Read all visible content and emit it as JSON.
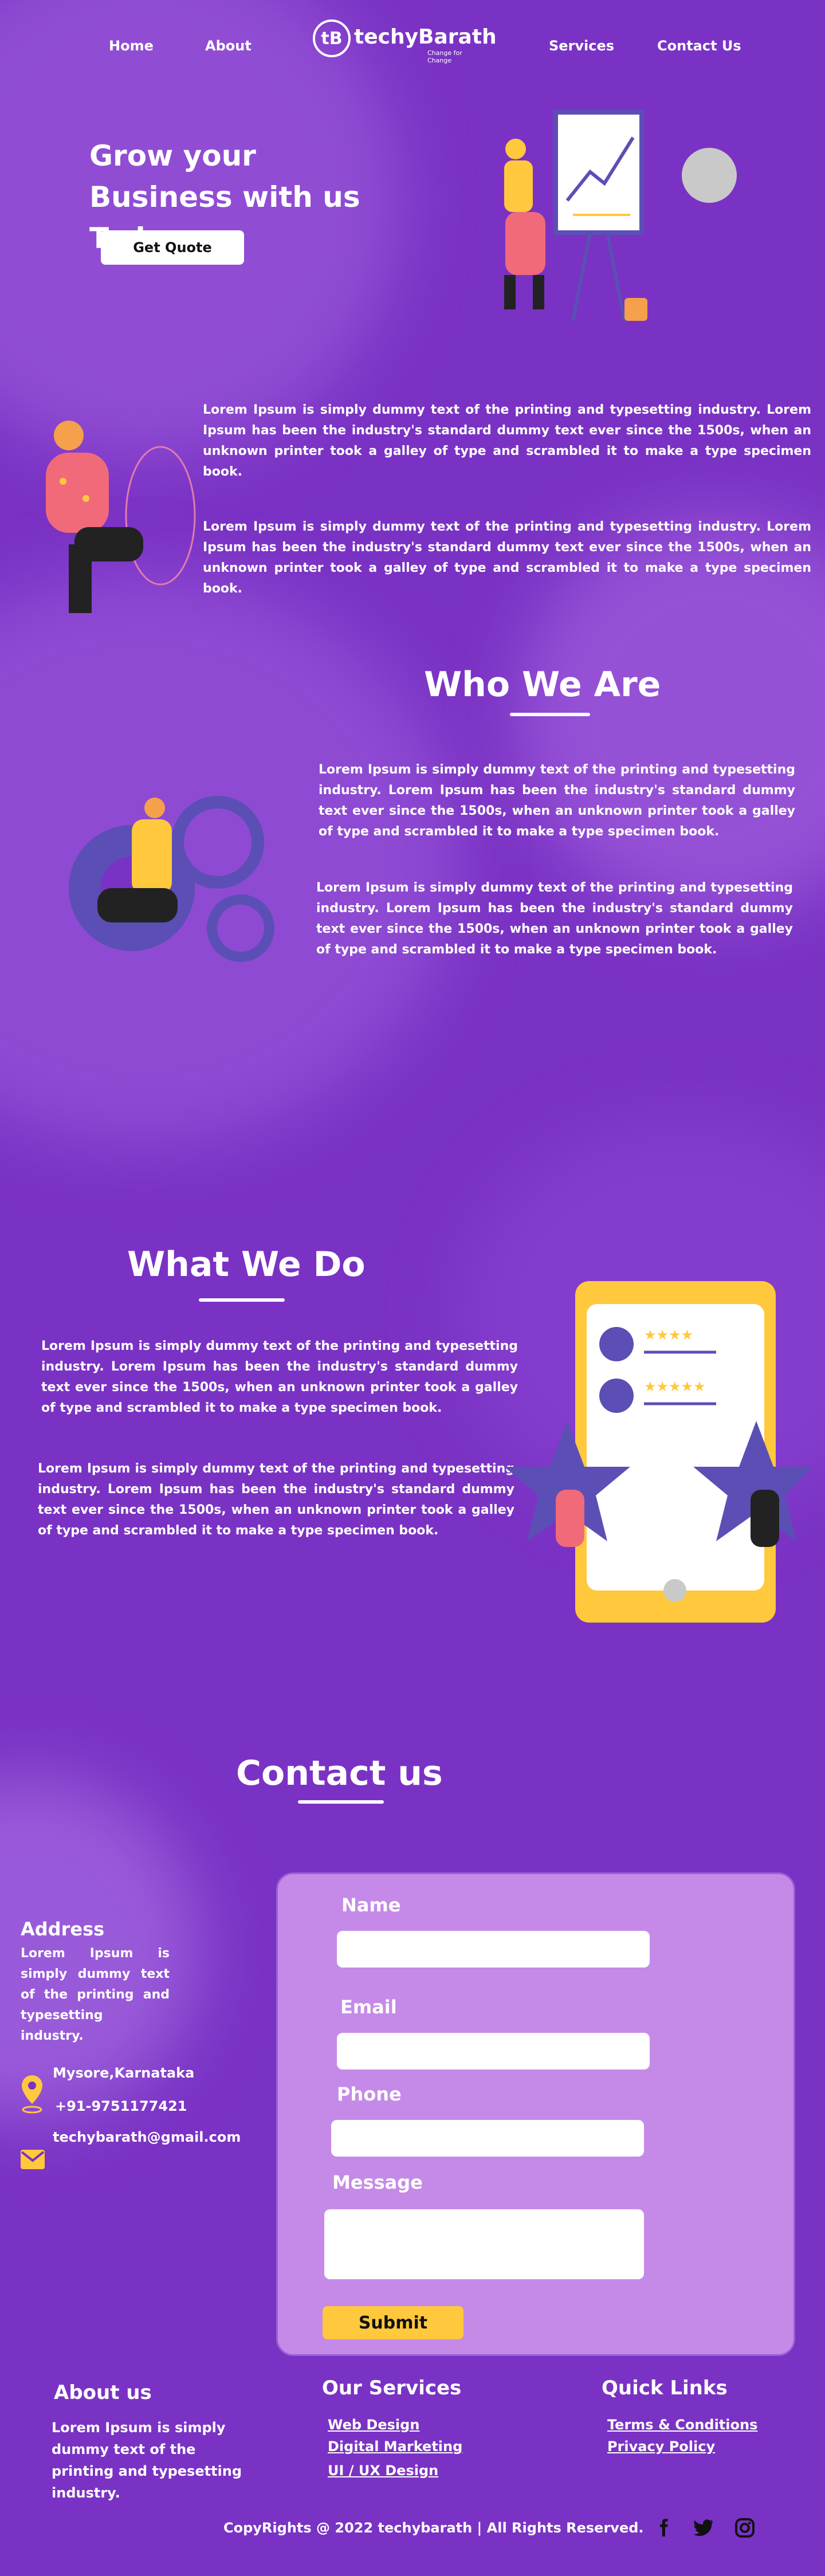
{
  "nav": {
    "home": "Home",
    "about": "About",
    "services": "Services",
    "contact": "Contact Us",
    "logo_initials": "tB",
    "logo_name": "techyBarath",
    "logo_tagline": "Change for Change"
  },
  "hero": {
    "title": "Grow your Business with us Today",
    "cta": "Get Quote"
  },
  "intro": {
    "p1": "Lorem Ipsum is simply dummy text of the printing and typesetting industry. Lorem Ipsum has been the industry's standard dummy text ever since the 1500s, when an unknown printer took a galley of type and scrambled it to make a type specimen book.",
    "p2": "Lorem Ipsum is simply dummy text of the printing and typesetting industry. Lorem Ipsum has been the industry's standard dummy text ever since the 1500s, when an unknown printer took a galley of type and scrambled it to make a type specimen book."
  },
  "who": {
    "title": "Who We Are",
    "p1": "Lorem Ipsum is simply dummy text of the printing and typesetting industry. Lorem Ipsum has been the industry's standard dummy text ever since the 1500s, when an unknown printer took a galley of type and scrambled it to make a type specimen book.",
    "p2": "Lorem Ipsum is simply dummy text of the printing and typesetting industry. Lorem Ipsum has been the industry's standard dummy text ever since the 1500s, when an unknown printer took a galley of type and scrambled it to make a type specimen book."
  },
  "what": {
    "title": "What We Do",
    "p1": "Lorem Ipsum is simply dummy text of the printing and typesetting industry. Lorem Ipsum has been the industry's standard dummy text ever since the 1500s, when an unknown printer took a galley of type and scrambled it to make a type specimen book.",
    "p2": "Lorem Ipsum is simply dummy text of the printing and typesetting industry. Lorem Ipsum has been the industry's standard dummy text ever since the 1500s, when an unknown printer took a galley of type and scrambled it to make a type specimen book."
  },
  "contact": {
    "title": "Contact us",
    "address_heading": "Address",
    "address_text": "Lorem Ipsum is simply dummy text of the printing and typesetting industry.",
    "location": "Mysore,Karnataka",
    "phone": "+91-9751177421",
    "email": "techybarath@gmail.com",
    "form": {
      "name_label": "Name",
      "email_label": "Email",
      "phone_label": "Phone",
      "message_label": "Message",
      "submit": "Submit"
    }
  },
  "footer": {
    "about_heading": "About us",
    "about_text": "Lorem Ipsum is simply dummy text of the printing and typesetting industry.",
    "services_heading": "Our Services",
    "services": [
      "Web Design",
      "Digital Marketing",
      "UI / UX Design"
    ],
    "links_heading": "Quick Links",
    "links": [
      "Terms & Conditions",
      "Privacy Policy"
    ],
    "copyright": "CopyRights @ 2022 techybarath | All Rights Reserved."
  },
  "colors": {
    "background": "#7a32c4",
    "form_panel": "#c58ae8",
    "accent_yellow": "#ffc83d",
    "illustration_blue": "#5b4fb5"
  },
  "icons": [
    "location-icon",
    "mail-icon",
    "facebook-icon",
    "twitter-icon",
    "instagram-icon"
  ]
}
